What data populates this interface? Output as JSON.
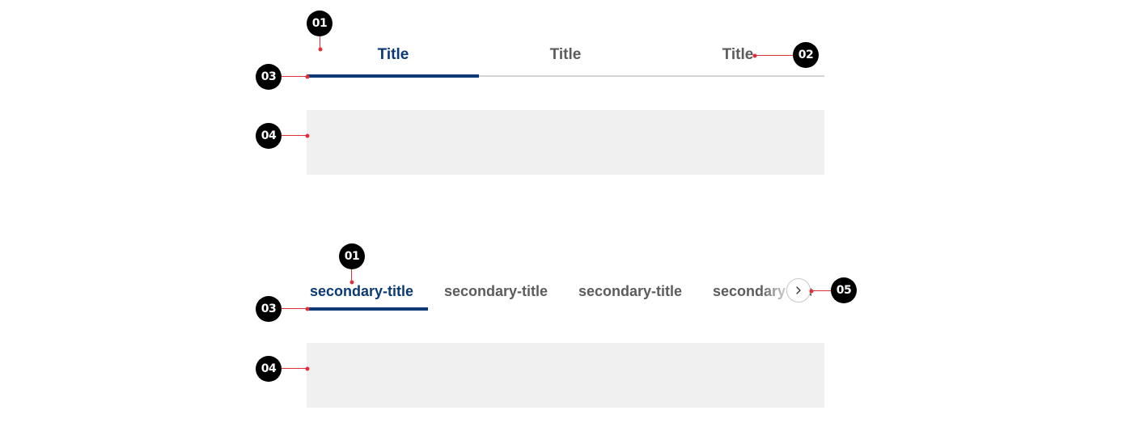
{
  "primary_tabs": {
    "items": [
      {
        "label": "Title",
        "active": true
      },
      {
        "label": "Title",
        "active": false
      },
      {
        "label": "Title",
        "active": false
      }
    ]
  },
  "secondary_tabs": {
    "items": [
      {
        "label": "secondary-title",
        "active": true
      },
      {
        "label": "secondary-title",
        "active": false
      },
      {
        "label": "secondary-title",
        "active": false
      },
      {
        "label": "secondary-title",
        "active": false
      }
    ],
    "scroll_icon": "chevron-right-icon"
  },
  "callouts": {
    "c01": "01",
    "c02": "02",
    "c03": "03",
    "c04": "04",
    "c05": "05"
  },
  "colors": {
    "active": "#0b3a75",
    "inactive": "#5c5c5c",
    "indicator_track": "#d3d3d3",
    "content_panel": "#f0f0f0",
    "callout_badge": "#000000",
    "callout_leader": "#e0303a"
  }
}
